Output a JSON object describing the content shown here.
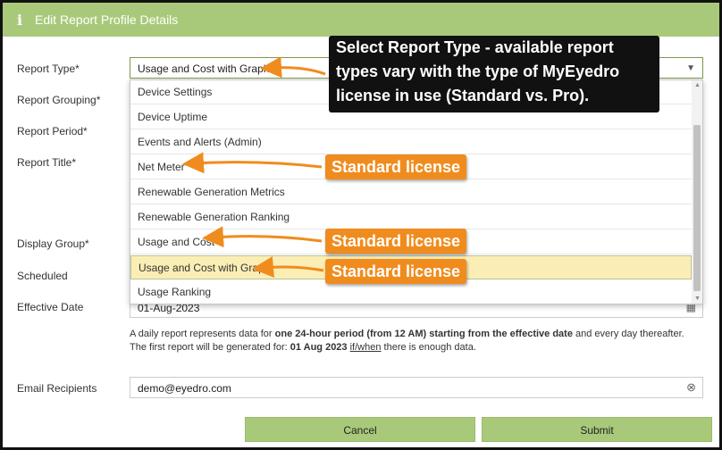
{
  "dialog": {
    "title": "Edit Report Profile Details"
  },
  "labels": {
    "report_type": "Report Type*",
    "report_grouping": "Report Grouping*",
    "report_period": "Report Period*",
    "report_title": "Report Title*",
    "display_group": "Display Group*",
    "scheduled": "Scheduled",
    "effective_date": "Effective Date",
    "email_recipients": "Email Recipients"
  },
  "report_type_select": {
    "value": "Usage and Cost with Graph"
  },
  "dropdown_options": [
    "Device Settings",
    "Device Uptime",
    "Events and Alerts (Admin)",
    "Net Meter",
    "Renewable Generation Metrics",
    "Renewable Generation Ranking",
    "Usage and Cost",
    "Usage and Cost with Graph",
    "Usage Ranking"
  ],
  "effective_date": {
    "value": "01-Aug-2023"
  },
  "note": {
    "part1": "A daily report represents data for ",
    "bold1": "one 24-hour period (from 12 AM) starting from the effective date",
    "part2": " and every day thereafter. The first report will be generated for: ",
    "bold2": "01 Aug 2023",
    "link": "if/when",
    "part3": " there is enough data."
  },
  "email_recipients": {
    "value": "demo@eyedro.com"
  },
  "buttons": {
    "cancel": "Cancel",
    "submit": "Submit"
  },
  "annotations": {
    "callout_line1": "Select Report Type - available report",
    "callout_line2": "types vary with the type of MyEyedro",
    "callout_line3": "license in use (Standard vs. Pro).",
    "badge_net_meter": "Standard license",
    "badge_usage_cost": "Standard license",
    "badge_usage_cost_graph": "Standard license"
  },
  "colors": {
    "header_green": "#a9c97a",
    "annotation_orange": "#f08c1e",
    "selected_row": "#fbeeb5"
  }
}
